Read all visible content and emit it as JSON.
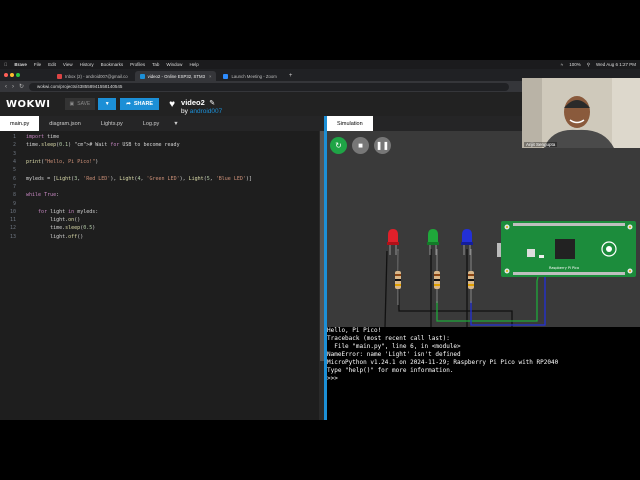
{
  "menubar": {
    "app": "Brave",
    "items": [
      "File",
      "Edit",
      "View",
      "History",
      "Bookmarks",
      "Profiles",
      "Tab",
      "Window",
      "Help"
    ],
    "battery": "100%",
    "clock": "Wed Aug 6  1:27 PM"
  },
  "tabs": [
    {
      "title": "Inbox (2) - android007@gmail.co",
      "active": false
    },
    {
      "title": "video2 - Online ESP32, STM3",
      "active": true
    },
    {
      "title": "Launch Meeting - Zoom",
      "active": false
    }
  ],
  "address": {
    "url": "wokwi.com/projects/438558941558140545"
  },
  "wokwi": {
    "logo": "WOKWI",
    "save_label": "SAVE",
    "share_label": "SHARE",
    "project_name": "video2",
    "by_label": "by",
    "author": "android007"
  },
  "editor": {
    "tabs": [
      "main.py",
      "diagram.json",
      "Lights.py",
      "Log.py"
    ],
    "active_tab": "main.py",
    "lines": [
      {
        "n": "1",
        "text": "import time"
      },
      {
        "n": "2",
        "text": "time.sleep(0.1) # Wait for USB to become ready"
      },
      {
        "n": "3",
        "text": ""
      },
      {
        "n": "4",
        "text": "print(\"Hello, Pi Pico!\")"
      },
      {
        "n": "5",
        "text": ""
      },
      {
        "n": "6",
        "text": "myleds = [Light(3, 'Red LED'), Light(4, 'Green LED'), Light(5, 'Blue LED')]"
      },
      {
        "n": "7",
        "text": ""
      },
      {
        "n": "8",
        "text": "while True:"
      },
      {
        "n": "9",
        "text": ""
      },
      {
        "n": "10",
        "text": "    for light in myleds:"
      },
      {
        "n": "11",
        "text": "        light.on()"
      },
      {
        "n": "12",
        "text": "        time.sleep(0.5)"
      },
      {
        "n": "13",
        "text": "        light.off()"
      }
    ]
  },
  "simulation": {
    "tab_label": "Simulation",
    "leds": [
      {
        "name": "red-led",
        "color": "#e0202a"
      },
      {
        "name": "green-led",
        "color": "#1fa83a"
      },
      {
        "name": "blue-led",
        "color": "#2330d8"
      }
    ],
    "board_label": "Raspberry Pi Pico",
    "board_color": "#1c8c3c"
  },
  "console": {
    "lines": [
      "Hello, Pi Pico!",
      "Traceback (most recent call last):",
      "  File \"main.py\", line 6, in <module>",
      "NameError: name 'Light' isn't defined",
      "MicroPython v1.24.1 on 2024-11-29; Raspberry Pi Pico with RP2040",
      "Type \"help()\" for more information.",
      ">>> "
    ]
  },
  "camera": {
    "label": "Arijit Sengupta"
  }
}
